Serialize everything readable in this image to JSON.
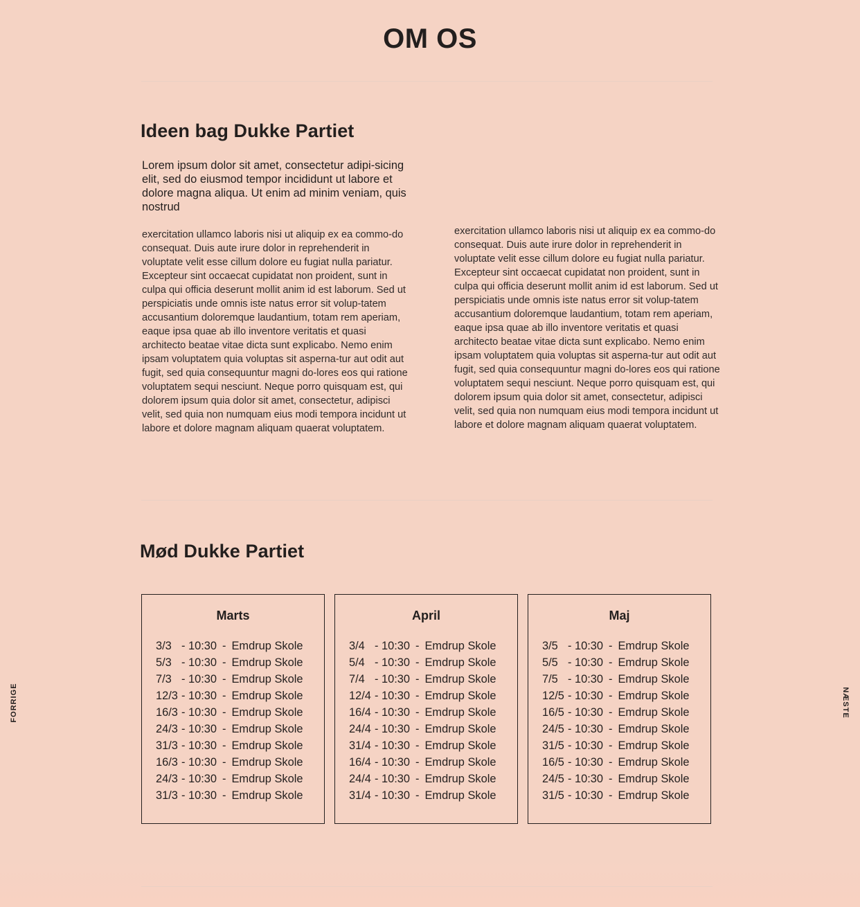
{
  "page": {
    "title": "OM OS"
  },
  "about": {
    "heading": "Ideen bag Dukke Partiet",
    "lead": "Lorem ipsum dolor sit amet, consectetur adipi-sicing elit, sed do eiusmod tempor incididunt ut labore et dolore magna aliqua. Ut enim ad minim veniam, quis nostrud",
    "col1": "exercitation ullamco laboris nisi ut aliquip ex ea commo-do consequat. Duis aute irure dolor in reprehenderit in voluptate velit esse cillum dolore eu fugiat nulla pariatur. Excepteur sint occaecat cupidatat non proident, sunt in culpa qui officia deserunt mollit anim id est laborum. Sed ut perspiciatis unde omnis iste natus error sit volup-tatem accusantium doloremque laudantium, totam rem aperiam, eaque ipsa quae ab illo inventore veritatis et quasi architecto beatae vitae dicta sunt explicabo. Nemo enim ipsam voluptatem quia voluptas sit asperna-tur aut odit aut fugit, sed quia consequuntur magni do-lores eos qui ratione voluptatem sequi nesciunt. Neque porro quisquam est, qui dolorem ipsum quia dolor sit amet, consectetur, adipisci velit, sed quia non numquam eius modi tempora incidunt ut labore et dolore magnam aliquam quaerat voluptatem.",
    "col2": "exercitation ullamco laboris nisi ut aliquip ex ea commo-do consequat. Duis aute irure dolor in reprehenderit in voluptate velit esse cillum dolore eu fugiat nulla pariatur. Excepteur sint occaecat cupidatat non proident, sunt in culpa qui officia deserunt mollit anim id est laborum. Sed ut perspiciatis unde omnis iste natus error sit volup-tatem accusantium doloremque laudantium, totam rem aperiam, eaque ipsa quae ab illo inventore veritatis et quasi architecto beatae vitae dicta sunt explicabo. Nemo enim ipsam voluptatem quia voluptas sit asperna-tur aut odit aut fugit, sed quia consequuntur magni do-lores eos qui ratione voluptatem sequi nesciunt. Neque porro quisquam est, qui dolorem ipsum quia dolor sit amet, consectetur, adipisci velit, sed quia non numquam eius modi tempora incidunt ut labore et dolore magnam aliquam quaerat voluptatem."
  },
  "meet": {
    "heading": "Mød Dukke Partiet",
    "months": [
      {
        "name": "Marts",
        "events": [
          {
            "date": "3/3",
            "time": "- 10:30",
            "sep": "-",
            "place": "Emdrup Skole"
          },
          {
            "date": "5/3",
            "time": "- 10:30",
            "sep": "-",
            "place": "Emdrup Skole"
          },
          {
            "date": "7/3",
            "time": "- 10:30",
            "sep": "-",
            "place": "Emdrup Skole"
          },
          {
            "date": "12/3",
            "time": "- 10:30",
            "sep": "-",
            "place": "Emdrup Skole"
          },
          {
            "date": "16/3",
            "time": "- 10:30",
            "sep": "-",
            "place": "Emdrup Skole"
          },
          {
            "date": "24/3",
            "time": "- 10:30",
            "sep": "-",
            "place": "Emdrup Skole"
          },
          {
            "date": "31/3",
            "time": "- 10:30",
            "sep": "-",
            "place": "Emdrup Skole"
          },
          {
            "date": "16/3",
            "time": "- 10:30",
            "sep": "-",
            "place": "Emdrup Skole"
          },
          {
            "date": "24/3",
            "time": "- 10:30",
            "sep": "-",
            "place": "Emdrup Skole"
          },
          {
            "date": "31/3",
            "time": "- 10:30",
            "sep": "-",
            "place": "Emdrup Skole"
          }
        ]
      },
      {
        "name": "April",
        "events": [
          {
            "date": "3/4",
            "time": "- 10:30",
            "sep": "-",
            "place": "Emdrup Skole"
          },
          {
            "date": "5/4",
            "time": "- 10:30",
            "sep": "-",
            "place": "Emdrup Skole"
          },
          {
            "date": "7/4",
            "time": "- 10:30",
            "sep": "-",
            "place": "Emdrup Skole"
          },
          {
            "date": "12/4",
            "time": "- 10:30",
            "sep": "-",
            "place": "Emdrup Skole"
          },
          {
            "date": "16/4",
            "time": "- 10:30",
            "sep": "-",
            "place": "Emdrup Skole"
          },
          {
            "date": "24/4",
            "time": "- 10:30",
            "sep": "-",
            "place": "Emdrup Skole"
          },
          {
            "date": "31/4",
            "time": "- 10:30",
            "sep": "-",
            "place": "Emdrup Skole"
          },
          {
            "date": "16/4",
            "time": "- 10:30",
            "sep": "-",
            "place": "Emdrup Skole"
          },
          {
            "date": "24/4",
            "time": "- 10:30",
            "sep": "-",
            "place": "Emdrup Skole"
          },
          {
            "date": "31/4",
            "time": "- 10:30",
            "sep": "-",
            "place": "Emdrup Skole"
          }
        ]
      },
      {
        "name": "Maj",
        "events": [
          {
            "date": "3/5",
            "time": "- 10:30",
            "sep": "-",
            "place": "Emdrup Skole"
          },
          {
            "date": "5/5",
            "time": "- 10:30",
            "sep": "-",
            "place": "Emdrup Skole"
          },
          {
            "date": "7/5",
            "time": "- 10:30",
            "sep": "-",
            "place": "Emdrup Skole"
          },
          {
            "date": "12/5",
            "time": "- 10:30",
            "sep": "-",
            "place": "Emdrup Skole"
          },
          {
            "date": "16/5",
            "time": "- 10:30",
            "sep": "-",
            "place": "Emdrup Skole"
          },
          {
            "date": "24/5",
            "time": "- 10:30",
            "sep": "-",
            "place": "Emdrup Skole"
          },
          {
            "date": "31/5",
            "time": "- 10:30",
            "sep": "-",
            "place": "Emdrup Skole"
          },
          {
            "date": "16/5",
            "time": "- 10:30",
            "sep": "-",
            "place": "Emdrup Skole"
          },
          {
            "date": "24/5",
            "time": "- 10:30",
            "sep": "-",
            "place": "Emdrup Skole"
          },
          {
            "date": "31/5",
            "time": "- 10:30",
            "sep": "-",
            "place": "Emdrup Skole"
          }
        ]
      }
    ]
  },
  "nav": {
    "prev_label": "FORRIGE",
    "next_label": "NÆSTE"
  },
  "colors": {
    "background": "#f5d3c4",
    "text": "#231f1e",
    "rule": "#ead0c4"
  }
}
